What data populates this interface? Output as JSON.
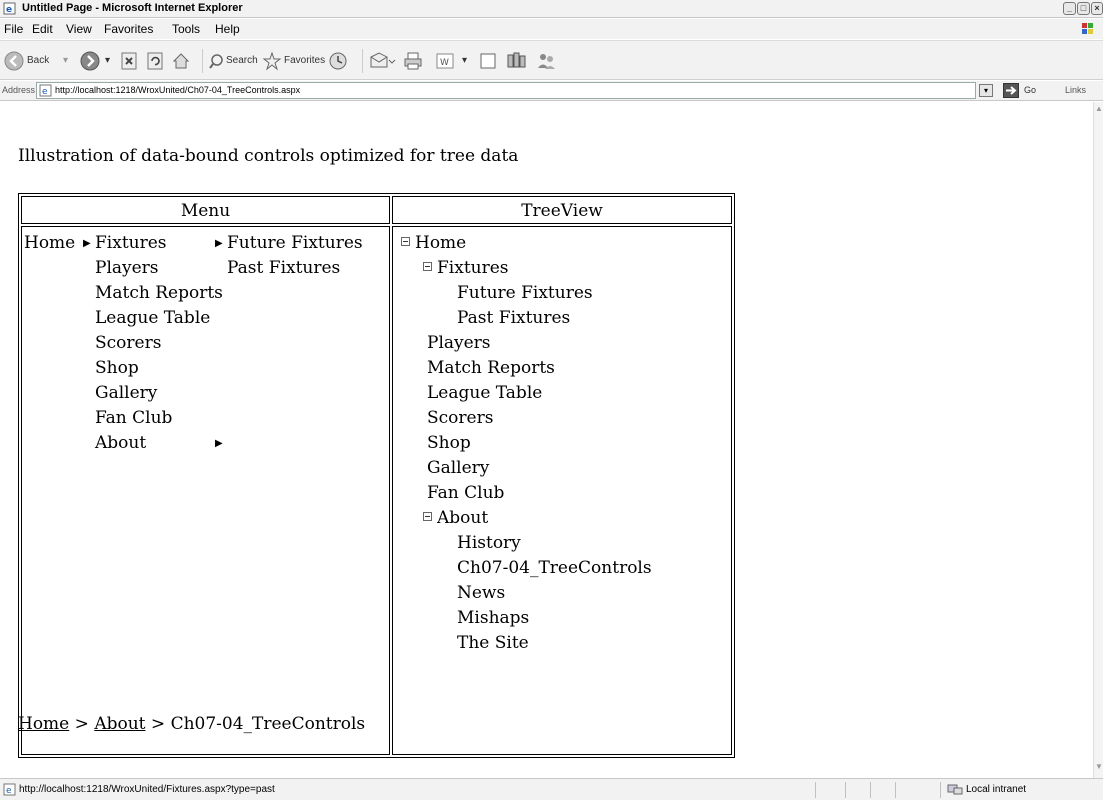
{
  "window": {
    "title": "Untitled Page - Microsoft Internet Explorer"
  },
  "menubar": [
    "File",
    "Edit",
    "View",
    "Favorites",
    "Tools",
    "Help"
  ],
  "toolbar": {
    "back_label": "Back",
    "search_label": "Search",
    "favorites_label": "Favorites"
  },
  "address": {
    "label": "Address",
    "url": "http://localhost:1218/WroxUnited/Ch07-04_TreeControls.aspx",
    "go_label": "Go",
    "links_label": "Links"
  },
  "page": {
    "heading": "Illustration of data-bound controls optimized for tree data",
    "menu_header": "Menu",
    "treeview_header": "TreeView",
    "menu": {
      "root": "Home",
      "items": [
        "Fixtures",
        "Players",
        "Match Reports",
        "League Table",
        "Scorers",
        "Shop",
        "Gallery",
        "Fan Club",
        "About"
      ],
      "fixtures_submenu": [
        "Future Fixtures",
        "Past Fixtures"
      ]
    },
    "tree": [
      {
        "label": "Home",
        "level": 0,
        "expander": true
      },
      {
        "label": "Fixtures",
        "level": 1,
        "expander": true
      },
      {
        "label": "Future Fixtures",
        "level": 2,
        "expander": false
      },
      {
        "label": "Past Fixtures",
        "level": 2,
        "expander": false
      },
      {
        "label": "Players",
        "level": 1,
        "expander": false
      },
      {
        "label": "Match Reports",
        "level": 1,
        "expander": false
      },
      {
        "label": "League Table",
        "level": 1,
        "expander": false
      },
      {
        "label": "Scorers",
        "level": 1,
        "expander": false
      },
      {
        "label": "Shop",
        "level": 1,
        "expander": false
      },
      {
        "label": "Gallery",
        "level": 1,
        "expander": false
      },
      {
        "label": "Fan Club",
        "level": 1,
        "expander": false
      },
      {
        "label": "About",
        "level": 1,
        "expander": true
      },
      {
        "label": "History",
        "level": 2,
        "expander": false
      },
      {
        "label": "Ch07-04_TreeControls",
        "level": 2,
        "expander": false
      },
      {
        "label": "News",
        "level": 2,
        "expander": false
      },
      {
        "label": "Mishaps",
        "level": 2,
        "expander": false
      },
      {
        "label": "The Site",
        "level": 2,
        "expander": false
      }
    ],
    "breadcrumb": {
      "home": "Home",
      "sep": ">",
      "about": "About",
      "current": "Ch07-04_TreeControls"
    }
  },
  "status": {
    "text": "http://localhost:1218/WroxUnited/Fixtures.aspx?type=past",
    "zone": "Local intranet"
  }
}
